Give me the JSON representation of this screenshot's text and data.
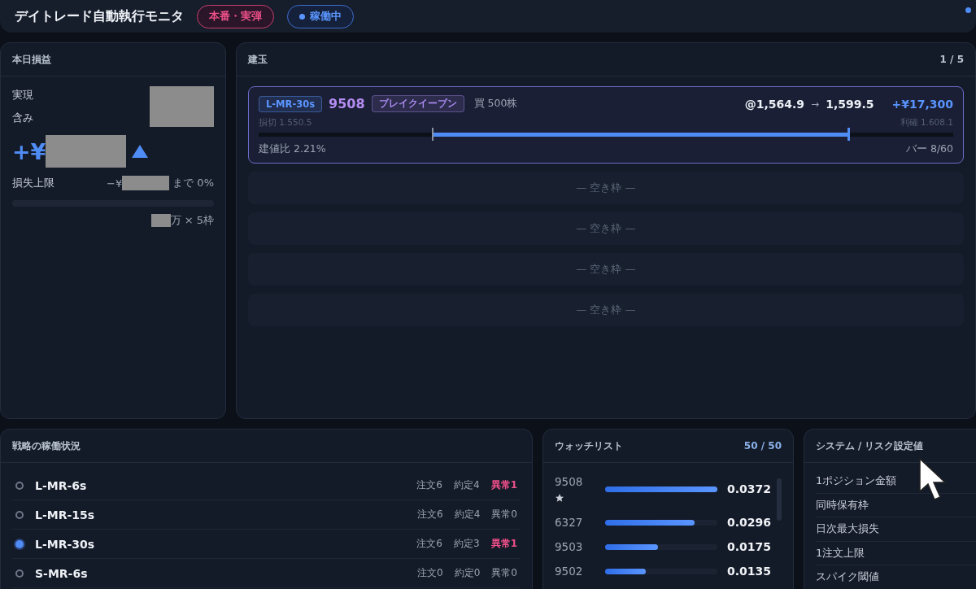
{
  "header": {
    "title": "デイトレード自動執行モニタ",
    "badges": [
      {
        "label": "本番・実弾",
        "kind": "mode"
      },
      {
        "label": "稼働中",
        "kind": "status"
      }
    ]
  },
  "pnl": {
    "title": "本日損益",
    "realized_label": "実現",
    "unrealized_label": "含み",
    "total_prefix": "+¥",
    "loss_limit": {
      "label": "損失上限",
      "prefix": "−¥",
      "suffix": "まで 0%",
      "level": 0
    },
    "capacity_suffix": "万 × 5枠"
  },
  "positions": {
    "title": "建玉",
    "count": "1 / 5",
    "items": [
      {
        "kind": "position",
        "strategy": "L-MR-30s",
        "code": "9508",
        "pattern": "ブレイクイーブン",
        "side": "買 500株",
        "entry": "@1,564.9",
        "arrow": "→",
        "current": "1,599.5",
        "pnl": "+¥17,300",
        "stop_label": "損切",
        "stop": "1.550.5",
        "take_label": "利確",
        "take": "1.608.1",
        "level": 0.85,
        "ratio": "建値比 2.21%",
        "bars": "バー 8/60"
      },
      {
        "kind": "empty",
        "label": "— 空き枠 —"
      },
      {
        "kind": "empty",
        "label": "— 空き枠 —"
      },
      {
        "kind": "empty",
        "label": "— 空き枠 —"
      },
      {
        "kind": "empty",
        "label": "— 空き枠 —"
      }
    ]
  },
  "strategies": {
    "title": "戦略の稼働状況",
    "items": [
      {
        "name": "L-MR-6s",
        "selected": false,
        "orders": "注文6",
        "fills": "約定4",
        "errors": "異常1",
        "alert": true
      },
      {
        "name": "L-MR-15s",
        "selected": false,
        "orders": "注文6",
        "fills": "約定4",
        "errors": "異常0",
        "alert": false
      },
      {
        "name": "L-MR-30s",
        "selected": true,
        "orders": "注文6",
        "fills": "約定3",
        "errors": "異常1",
        "alert": true
      },
      {
        "name": "S-MR-6s",
        "selected": false,
        "orders": "注文0",
        "fills": "約定0",
        "errors": "異常0",
        "alert": false
      }
    ]
  },
  "watchlist": {
    "title": "ウォッチリスト",
    "count": "50 / 50",
    "items": [
      {
        "code": "9508",
        "starred": true,
        "level": 1,
        "value": "0.0372"
      },
      {
        "code": "6327",
        "starred": false,
        "level": 0.8,
        "value": "0.0296"
      },
      {
        "code": "9503",
        "starred": false,
        "level": 0.47,
        "value": "0.0175"
      },
      {
        "code": "9502",
        "starred": false,
        "level": 0.36,
        "value": "0.0135"
      }
    ]
  },
  "settings": {
    "title": "システム / リスク設定値",
    "rows": [
      "1ポジション金額",
      "同時保有枠",
      "日次最大損失",
      "1注文上限",
      "スパイク閾値"
    ]
  }
}
